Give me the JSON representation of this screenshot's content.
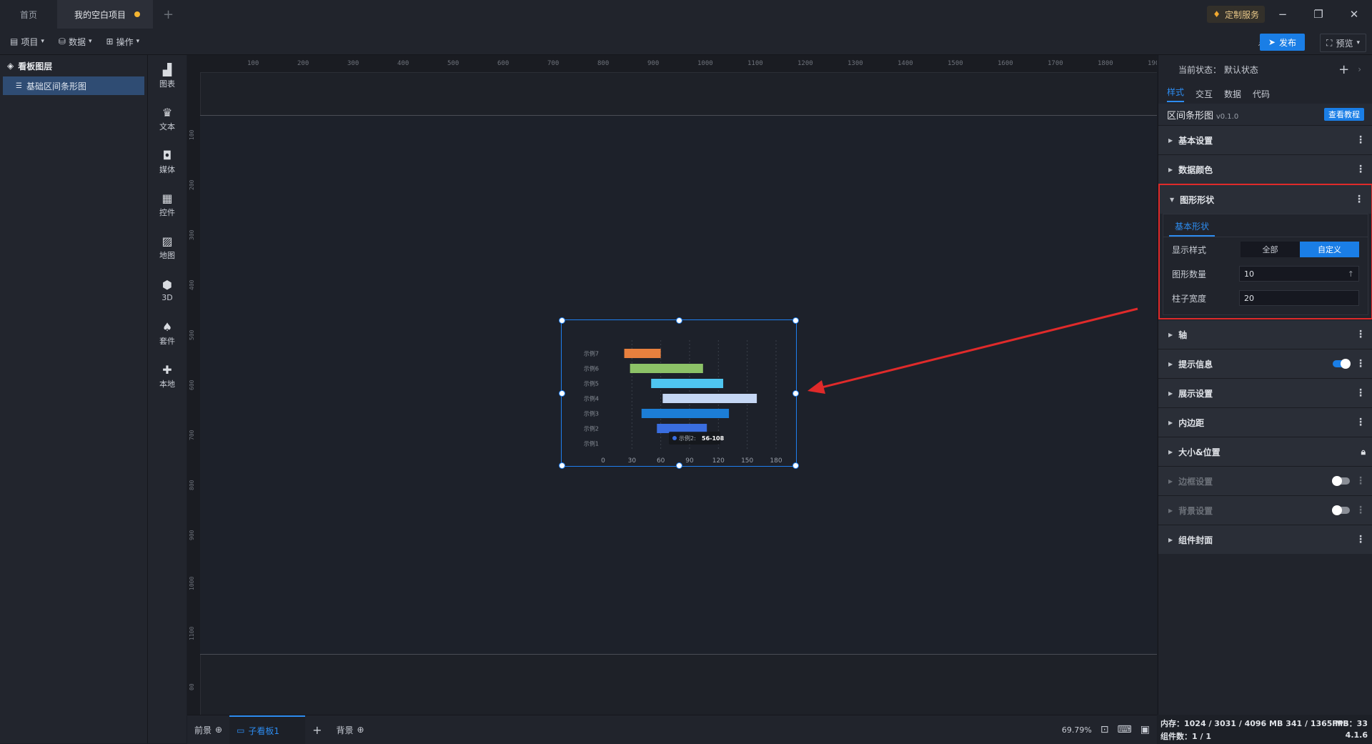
{
  "titlebar": {
    "tabs": [
      {
        "label": "首页"
      },
      {
        "label": "我的空白项目"
      }
    ],
    "custom_service": "定制服务"
  },
  "toolbar": {
    "menus": [
      "项目",
      "数据",
      "操作"
    ],
    "publish": "发布",
    "preview": "预览"
  },
  "layers": {
    "title": "看板图层",
    "items": [
      "基础区间条形图"
    ]
  },
  "components": [
    "图表",
    "文本",
    "媒体",
    "控件",
    "地图",
    "3D",
    "套件",
    "本地"
  ],
  "ruler": {
    "top": [
      "100",
      "200",
      "300",
      "400",
      "500",
      "600",
      "700",
      "800",
      "900",
      "1000",
      "1100",
      "1200",
      "1300",
      "1400",
      "1500",
      "1600",
      "1700",
      "1800",
      "1900"
    ],
    "left": [
      "100",
      "200",
      "300",
      "400",
      "500",
      "600",
      "700",
      "800",
      "900",
      "1000",
      "1100",
      "00"
    ]
  },
  "chart_data": {
    "type": "bar",
    "orientation": "horizontal-range",
    "categories": [
      "示例7",
      "示例6",
      "示例5",
      "示例4",
      "示例3",
      "示例2",
      "示例1"
    ],
    "ranges": [
      [
        22,
        60
      ],
      [
        28,
        104
      ],
      [
        50,
        125
      ],
      [
        62,
        160
      ],
      [
        40,
        131
      ],
      [
        56,
        108
      ],
      null
    ],
    "colors": [
      "#e8803e",
      "#8cc267",
      "#4fc6f0",
      "#c5d7f4",
      "#1c7ed6",
      "#3a6ee0",
      "#7aa4e8"
    ],
    "x_ticks": [
      "0",
      "30",
      "60",
      "90",
      "120",
      "150",
      "180"
    ],
    "xlim": [
      0,
      180
    ],
    "tooltip": {
      "series": "示例2:",
      "value": "56-108"
    }
  },
  "bottom": {
    "front": "前景",
    "sub_board": "子看板1",
    "background": "背景",
    "zoom": "69.79%"
  },
  "right_panel": {
    "state_label": "当前状态：",
    "state_value": "默认状态",
    "tabs": [
      "样式",
      "交互",
      "数据",
      "代码"
    ],
    "component_name": "区间条形图",
    "version": "v0.1.0",
    "tutorial": "查看教程",
    "sections_top": [
      "基本设置",
      "数据颜色"
    ],
    "shape_section": {
      "title": "图形形状",
      "sub_tab": "基本形状",
      "display_style_label": "显示样式",
      "display_options": [
        "全部",
        "自定义"
      ],
      "shape_count_label": "图形数量",
      "shape_count": "10",
      "bar_width_label": "柱子宽度",
      "bar_width": "20"
    },
    "sections_bottom": [
      "轴",
      "提示信息",
      "展示设置",
      "内边距",
      "大小&位置",
      "边框设置",
      "背景设置",
      "组件封面"
    ]
  },
  "status": {
    "memory": "内存：1024 / 3031 / 4096 MB  341 / 1365 MB",
    "fps": "FPS：33",
    "components": "组件数：1 / 1",
    "version": "4.1.6"
  }
}
